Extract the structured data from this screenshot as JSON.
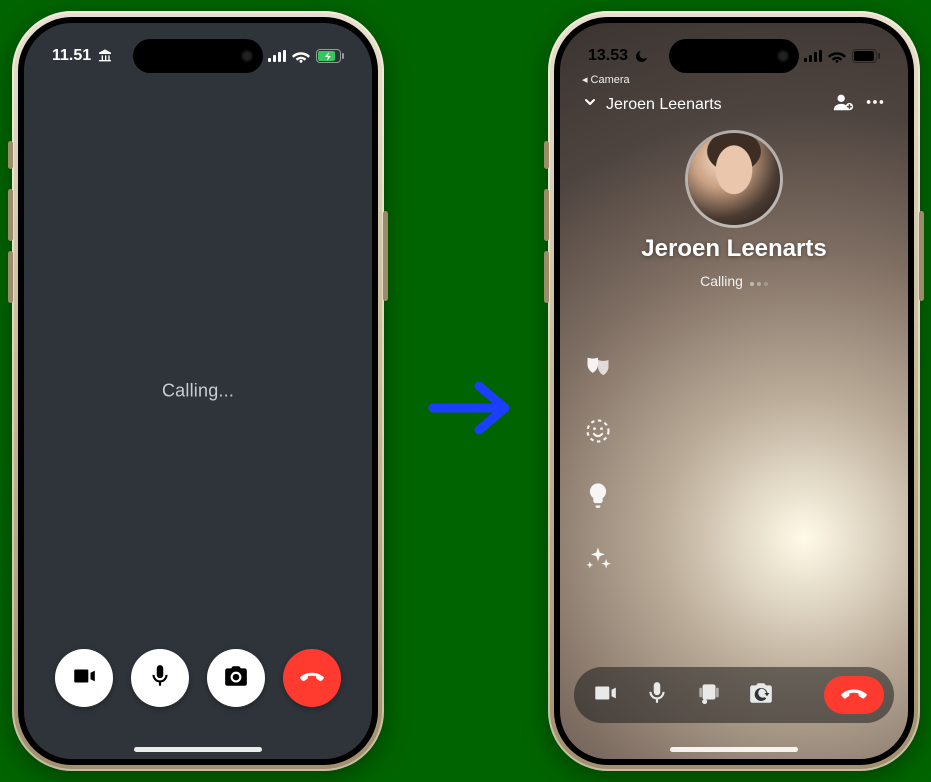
{
  "arrow": {
    "color": "#1a3fff"
  },
  "phone_left": {
    "status": {
      "time": "11.51",
      "left_icon": "bank-icon",
      "signal_bars": 4,
      "wifi": true,
      "battery": {
        "charging": true,
        "fill_color": "#34c759"
      }
    },
    "center_message": "Calling...",
    "actions": [
      {
        "name": "video-button",
        "icon": "video-icon",
        "style": "white"
      },
      {
        "name": "mic-button",
        "icon": "mic-icon",
        "style": "white"
      },
      {
        "name": "camera-button",
        "icon": "camera-icon",
        "style": "white"
      },
      {
        "name": "end-call-button",
        "icon": "phone-down-icon",
        "style": "red"
      }
    ]
  },
  "phone_right": {
    "status": {
      "time": "13.53",
      "left_icon": "moon-icon",
      "signal_bars": 4,
      "wifi": true,
      "battery": {
        "charging": false,
        "fill_color": "#000"
      }
    },
    "breadcrumb": "Camera",
    "header": {
      "title": "Jeroen Leenarts",
      "expand_icon": "chevron-down-icon",
      "tools": [
        {
          "name": "add-person-button",
          "icon": "person-add-icon"
        },
        {
          "name": "more-button",
          "icon": "more-icon"
        }
      ]
    },
    "hero": {
      "name": "Jeroen Leenarts",
      "subtitle": "Calling"
    },
    "effects": [
      {
        "name": "effects-masks-button",
        "icon": "masks-icon"
      },
      {
        "name": "effects-sticker-button",
        "icon": "sticker-icon"
      },
      {
        "name": "effects-light-button",
        "icon": "bulb-icon"
      },
      {
        "name": "effects-sparkle-button",
        "icon": "sparkle-icon"
      }
    ],
    "toolbar": [
      {
        "name": "tb-video-button",
        "icon": "video-icon"
      },
      {
        "name": "tb-mic-button",
        "icon": "mic-icon"
      },
      {
        "name": "tb-stage-button",
        "icon": "stage-icon"
      },
      {
        "name": "tb-camera-flip-button",
        "icon": "camera-flip-icon"
      }
    ],
    "toolbar_end": {
      "name": "tb-end-call-button",
      "icon": "phone-down-icon"
    }
  }
}
